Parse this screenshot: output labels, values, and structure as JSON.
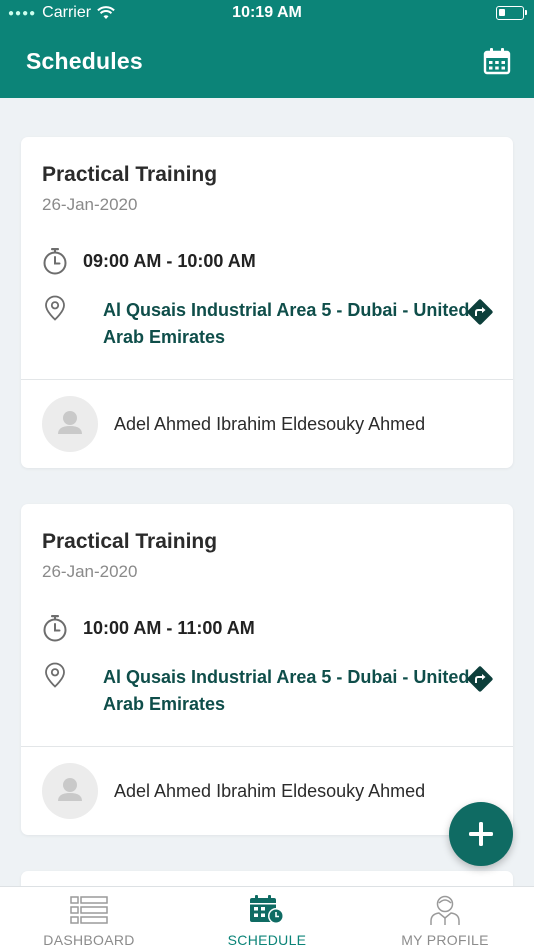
{
  "status_bar": {
    "carrier": "Carrier",
    "time": "10:19 AM"
  },
  "header": {
    "title": "Schedules",
    "action_icon": "calendar-icon"
  },
  "schedules": [
    {
      "title": "Practical Training",
      "date": "26-Jan-2020",
      "time": "09:00 AM - 10:00 AM",
      "location": "Al Qusais Industrial Area 5 - Dubai - United Arab Emirates",
      "person": "Adel Ahmed Ibrahim Eldesouky Ahmed"
    },
    {
      "title": "Practical Training",
      "date": "26-Jan-2020",
      "time": "10:00 AM - 11:00 AM",
      "location": "Al Qusais Industrial Area 5 - Dubai - United Arab Emirates",
      "person": "Adel Ahmed Ibrahim Eldesouky Ahmed"
    }
  ],
  "tabs": [
    {
      "label": "DASHBOARD",
      "icon": "dashboard-icon",
      "active": false
    },
    {
      "label": "SCHEDULE",
      "icon": "schedule-icon",
      "active": true
    },
    {
      "label": "MY PROFILE",
      "icon": "profile-icon",
      "active": false
    }
  ],
  "colors": {
    "primary": "#0c8478",
    "fab": "#0f6b63",
    "location_text": "#0f4e4a",
    "background": "#eef2f5"
  }
}
